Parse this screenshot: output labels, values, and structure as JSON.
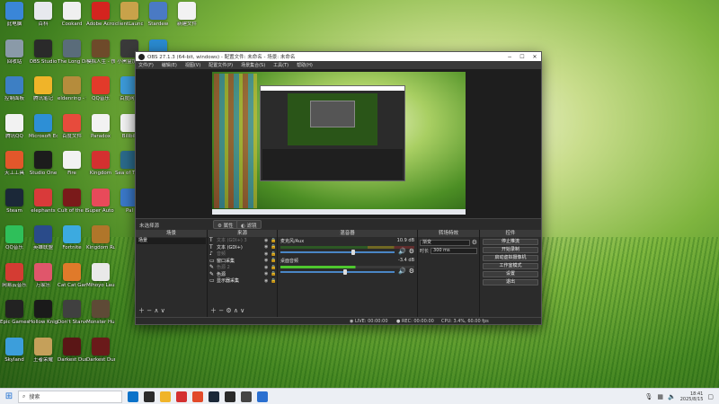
{
  "desktop": {
    "icons": [
      {
        "label": "此电脑",
        "color": "#3a86d8"
      },
      {
        "label": "回收站",
        "color": "#8a9aa8"
      },
      {
        "label": "控制面板",
        "color": "#3d7fc4"
      },
      {
        "label": "腾讯QQ",
        "color": "#f2f2f2"
      },
      {
        "label": "天工工具",
        "color": "#e2572b"
      },
      {
        "label": "Steam",
        "color": "#1b2838"
      },
      {
        "label": "QQ音乐",
        "color": "#2fbf5a"
      },
      {
        "label": "网易云音乐",
        "color": "#d43c33"
      },
      {
        "label": "Epic Games Launcher",
        "color": "#222222"
      },
      {
        "label": "Skyland",
        "color": "#3c9edb"
      },
      {
        "label": "百科",
        "color": "#e7e9ee"
      },
      {
        "label": "OBS Studio",
        "color": "#2a2a2a"
      },
      {
        "label": "腾讯笔记",
        "color": "#f0b429"
      },
      {
        "label": "Microsoft Edge",
        "color": "#2d8fd6"
      },
      {
        "label": "Studio One",
        "color": "#1c1c1c"
      },
      {
        "label": "elephants",
        "color": "#d93a3a"
      },
      {
        "label": "英雄联盟",
        "color": "#2a4b8a"
      },
      {
        "label": "万家乐",
        "color": "#e0566b"
      },
      {
        "label": "Hollow Knight",
        "color": "#1a1a1a"
      },
      {
        "label": "王者荣耀",
        "color": "#c5a05a"
      },
      {
        "label": "Cookard",
        "color": "#f0f0f0"
      },
      {
        "label": "The Long Dark",
        "color": "#5a6c7a"
      },
      {
        "label": "eldenring - 快捷方式",
        "color": "#b58c3c"
      },
      {
        "label": "百度文件",
        "color": "#e74b3c"
      },
      {
        "label": "Fire",
        "color": "#f2f2f2"
      },
      {
        "label": "Cult of the Lamb",
        "color": "#7a1a1a"
      },
      {
        "label": "Fortnite",
        "color": "#3caae0"
      },
      {
        "label": "Cat Cat Game",
        "color": "#e07a2a"
      },
      {
        "label": "Don't Starve",
        "color": "#404040"
      },
      {
        "label": "Darkest Dungeon II",
        "color": "#5a1616"
      },
      {
        "label": "Adobe Acrobat",
        "color": "#d4241f"
      },
      {
        "label": "模拟人生 - 快捷方式",
        "color": "#6e4a2a"
      },
      {
        "label": "QQ音乐",
        "color": "#e23a2a"
      },
      {
        "label": "Paradox",
        "color": "#f2f2f2"
      },
      {
        "label": "Kingdom",
        "color": "#d43030"
      },
      {
        "label": "Super Auto Pets",
        "color": "#e84a5a"
      },
      {
        "label": "Kingdom Rush Origins",
        "color": "#b0762a"
      },
      {
        "label": "Mihoyo Launcher",
        "color": "#e9e9e9"
      },
      {
        "label": "Monster Hunter",
        "color": "#5e4a36"
      },
      {
        "label": "Darkest Dungeon",
        "color": "#6a1a1a"
      },
      {
        "label": "clientLauncher",
        "color": "#c8a24a"
      },
      {
        "label": "小黑盒加速",
        "color": "#3a3a3a"
      },
      {
        "label": "百度网盘",
        "color": "#3c9ad8"
      },
      {
        "label": "Bilibili",
        "color": "#f2f2f2"
      },
      {
        "label": "Sea of Thieves",
        "color": "#2b6a8a"
      },
      {
        "label": "Pal",
        "color": "#3a78c8"
      },
      {
        "label": "Stardew",
        "color": "#4a7ac4"
      },
      {
        "label": "加速器",
        "color": "#2a8ad0"
      },
      {
        "label": "文档",
        "color": "#f2f2f2"
      },
      {
        "label": "Black Book",
        "color": "#3a2a22"
      },
      {
        "label": "新建文件",
        "color": "#f2f2f2"
      }
    ]
  },
  "obs": {
    "title": "OBS 27.1.3 (64-bit, windows) - 配置文件: 未命名 - 场景: 未命名",
    "menu": [
      "文件(F)",
      "编辑(E)",
      "视图(V)",
      "配置文件(P)",
      "场景集合(S)",
      "工具(T)",
      "帮助(H)"
    ],
    "tabs": {
      "selected_label": "未选择源",
      "properties": "⚙ 属性",
      "filters": "◐ 滤镜"
    },
    "scenes": {
      "header": "场景",
      "items": [
        "场景"
      ]
    },
    "sources": {
      "header": "来源",
      "items": [
        {
          "icon": "T",
          "name": "文本 (GDI+) 3",
          "dim": true
        },
        {
          "icon": "T",
          "name": "文本 (GDI+)",
          "dim": false
        },
        {
          "icon": "♪",
          "name": "音频",
          "dim": true
        },
        {
          "icon": "▭",
          "name": "窗口采集",
          "dim": false
        },
        {
          "icon": "✎",
          "name": "色源 2",
          "dim": true
        },
        {
          "icon": "✎",
          "name": "色源",
          "dim": false
        },
        {
          "icon": "▭",
          "name": "显示器采集",
          "dim": false
        }
      ]
    },
    "mixer": {
      "header": "混音器",
      "tracks": [
        {
          "name": "麦克风/Aux",
          "db": "10.9 dB",
          "level": 0.62
        },
        {
          "name": "桌面音频",
          "db": "-3.4 dB",
          "level": 0.55
        }
      ]
    },
    "transitions": {
      "header": "转场特效",
      "type": "渐变",
      "duration_label": "时长",
      "duration": "300 ms"
    },
    "controls": {
      "header": "控件",
      "buttons": [
        "停止推流",
        "开始录制",
        "启动虚拟摄像机",
        "工作室模式",
        "设置",
        "退出"
      ]
    },
    "status": {
      "live": "◉ LIVE: 00:00:00",
      "rec": "● REC: 00:00:00",
      "cpu": "CPU: 3.4%, 60.00 fps"
    },
    "footer": "＋ − ∧ ∨"
  },
  "taskbar": {
    "search_placeholder": "搜索",
    "apps": [
      "#0a72c9",
      "#2b2b2b",
      "#f0b429",
      "#d43030",
      "#e24a2a",
      "#1b2838",
      "#2a2a2a",
      "#444444",
      "#2a6fd0"
    ],
    "time": "18:41",
    "date": "2025/8/15"
  }
}
